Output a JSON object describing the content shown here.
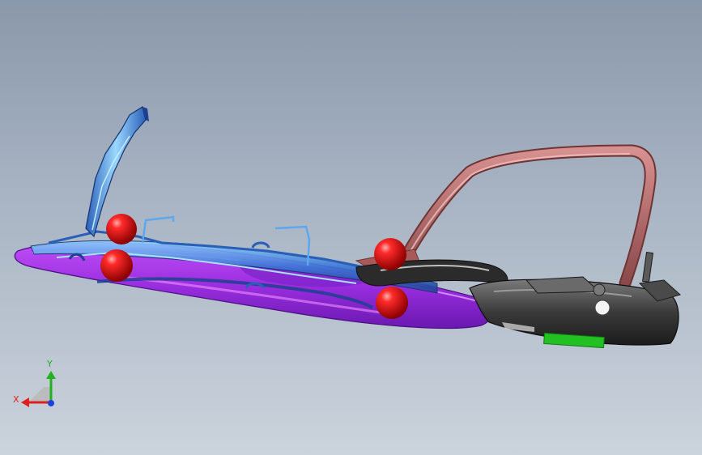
{
  "viewport": {
    "background_top": "#8a98ab",
    "background_bottom": "#cbd3dc"
  },
  "model": {
    "base_plate_color": "#a030e8",
    "frame_color": "#3a78d6",
    "handle_color": "#b86a6a",
    "clamp_body_color": "#3c3c3c",
    "locator_sphere_color": "#e41414",
    "pad_color": "#22c022"
  },
  "triad": {
    "x_label": "X",
    "y_label": "Y",
    "x_color": "#e02020",
    "y_color": "#20b020",
    "z_color": "#2040e0"
  }
}
